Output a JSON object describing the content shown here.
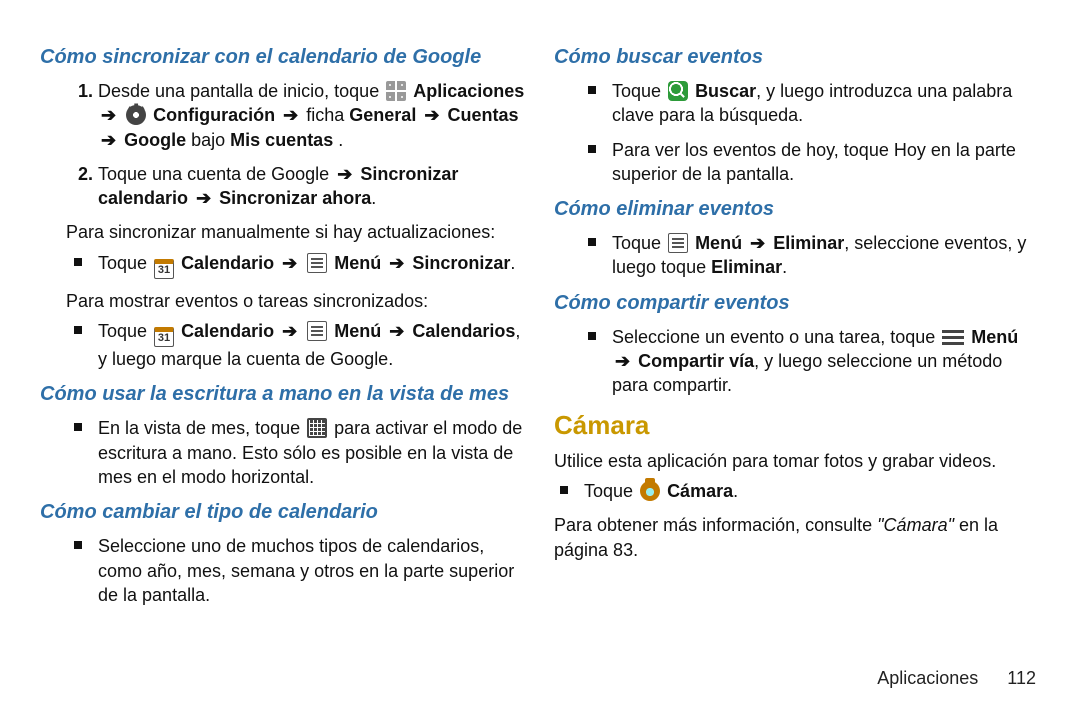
{
  "arrow": "➔",
  "left": {
    "h1": "Cómo sincronizar con el calendario de Google",
    "step1_a": "Desde una pantalla de inicio, toque ",
    "step1_apps": "Aplicaciones",
    "step1_conf": "Configuración",
    "step1_tab": " ficha ",
    "step1_general": "General",
    "step1_cuentas": "Cuentas",
    "step1_google": "Google",
    "step1_bajo": " bajo ",
    "step1_mis": "Mis cuentas",
    "step1_dot": ".",
    "step2_a": "Toque una cuenta de Google ",
    "step2_sync": "Sincronizar calendario",
    "step2_now": "Sincronizar ahora",
    "p_manual": "Para sincronizar manualmente si hay actualizaciones:",
    "b1_toque": "Toque ",
    "b1_cal31": "31",
    "b1_calendario": "Calendario",
    "b1_menu": "Menú",
    "b1_sincronizar": "Sincronizar",
    "p_mostrar": "Para mostrar eventos o tareas sincronizados:",
    "b2_calendarios": "Calendarios",
    "b2_tail": ", y luego marque la cuenta de Google.",
    "h2": "Cómo usar la escritura a mano en la vista de mes",
    "b3_a": "En la vista de mes, toque ",
    "b3_b": " para activar el modo de escritura a mano. Esto sólo es posible en la vista de mes en el modo horizontal.",
    "h3": "Cómo cambiar el tipo de calendario",
    "b4": "Seleccione uno de muchos tipos de calendarios, como año, mes, semana y otros en la parte superior de la pantalla."
  },
  "right": {
    "h1": "Cómo buscar eventos",
    "r1_toque": "Toque ",
    "r1_buscar": "Buscar",
    "r1_tail": ", y luego introduzca una palabra clave para la búsqueda.",
    "r2": "Para ver los eventos de hoy, toque Hoy en la parte superior de la pantalla.",
    "h2": "Cómo eliminar eventos",
    "r3_menu": "Menú",
    "r3_elim": "Eliminar",
    "r3_tail": ", seleccione eventos, y luego toque ",
    "r3_elim2": "Eliminar",
    "h3": "Cómo compartir eventos",
    "r4_a": "Seleccione un evento o una tarea, toque ",
    "r4_menu": "Menú",
    "r4_comp": "Compartir vía",
    "r4_tail": ", y luego seleccione un método para compartir.",
    "h_camara": "Cámara",
    "p_cam_desc": "Utilice esta aplicación para tomar fotos y grabar videos.",
    "r5_toque": "Toque ",
    "r5_camara": "Cámara",
    "p_cam_more_a": "Para obtener más información, consulte ",
    "p_cam_more_link": "\"Cámara\"",
    "p_cam_more_b": " en la página 83."
  },
  "footer": {
    "section": "Aplicaciones",
    "page": "112"
  }
}
